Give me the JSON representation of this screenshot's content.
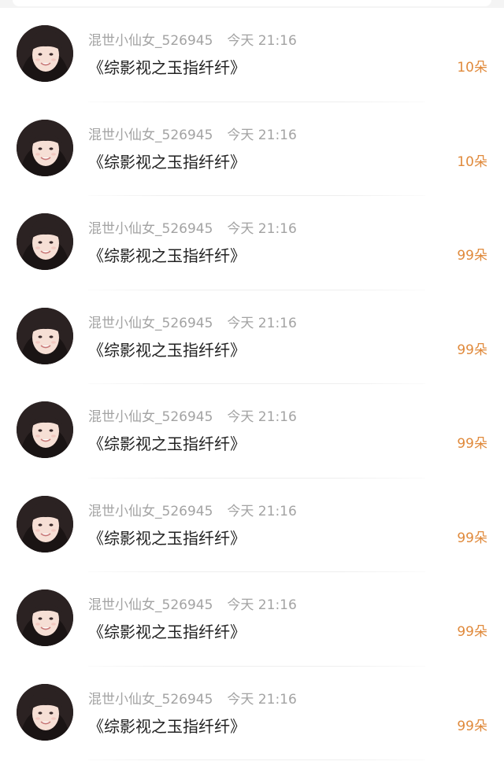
{
  "gifts": [
    {
      "username": "混世小仙女_526945",
      "time": "今天 21:16",
      "title": "《综影视之玉指纤纤》",
      "amount": "10朵"
    },
    {
      "username": "混世小仙女_526945",
      "time": "今天 21:16",
      "title": "《综影视之玉指纤纤》",
      "amount": "10朵"
    },
    {
      "username": "混世小仙女_526945",
      "time": "今天 21:16",
      "title": "《综影视之玉指纤纤》",
      "amount": "99朵"
    },
    {
      "username": "混世小仙女_526945",
      "time": "今天 21:16",
      "title": "《综影视之玉指纤纤》",
      "amount": "99朵"
    },
    {
      "username": "混世小仙女_526945",
      "time": "今天 21:16",
      "title": "《综影视之玉指纤纤》",
      "amount": "99朵"
    },
    {
      "username": "混世小仙女_526945",
      "time": "今天 21:16",
      "title": "《综影视之玉指纤纤》",
      "amount": "99朵"
    },
    {
      "username": "混世小仙女_526945",
      "time": "今天 21:16",
      "title": "《综影视之玉指纤纤》",
      "amount": "99朵"
    },
    {
      "username": "混世小仙女_526945",
      "time": "今天 21:16",
      "title": "《综影视之玉指纤纤》",
      "amount": "99朵"
    }
  ],
  "colors": {
    "amount": "#e08a3c",
    "meta": "#a3a3a3",
    "title": "#222222"
  },
  "icons": {
    "avatar": "user-avatar-photo"
  }
}
